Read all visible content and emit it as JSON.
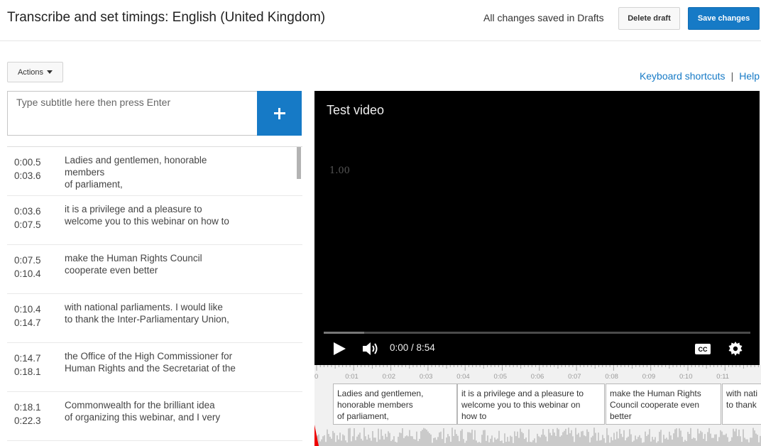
{
  "header": {
    "title": "Transcribe and set timings: English (United Kingdom)",
    "saved_status": "All changes saved in Drafts",
    "delete_label": "Delete draft",
    "save_label": "Save changes"
  },
  "toolbar": {
    "actions_label": "Actions",
    "keyboard_shortcuts": "Keyboard shortcuts",
    "separator": "|",
    "help": "Help"
  },
  "subtitle_input": {
    "placeholder": "Type subtitle here then press Enter"
  },
  "subtitles": [
    {
      "start": "0:00.5",
      "end": "0:03.6",
      "lines": [
        "Ladies and gentlemen, honorable",
        "members",
        "of parliament,"
      ]
    },
    {
      "start": "0:03.6",
      "end": "0:07.5",
      "lines": [
        "it is a privilege and a pleasure to",
        "welcome you to this webinar on how to"
      ]
    },
    {
      "start": "0:07.5",
      "end": "0:10.4",
      "lines": [
        "make the Human Rights Council",
        "cooperate even better"
      ]
    },
    {
      "start": "0:10.4",
      "end": "0:14.7",
      "lines": [
        "with national parliaments. I would like",
        "to thank the Inter-Parliamentary Union,"
      ]
    },
    {
      "start": "0:14.7",
      "end": "0:18.1",
      "lines": [
        "the Office of the High Commissioner for",
        "Human Rights and the Secretariat of the"
      ]
    },
    {
      "start": "0:18.1",
      "end": "0:22.3",
      "lines": [
        "Commonwealth for the brilliant idea",
        "of organizing this webinar, and I very"
      ]
    }
  ],
  "player": {
    "video_title": "Test video",
    "speed": "1.00",
    "timecode": "0:00 / 8:54",
    "cc_label": "CC",
    "progress": 0.095
  },
  "timeline": {
    "tick_labels": [
      "0",
      "0:01",
      "0:02",
      "0:03",
      "0:04",
      "0:05",
      "0:06",
      "0:07",
      "0:08",
      "0:09",
      "0:10",
      "0:11"
    ],
    "cues": [
      [
        "Ladies and gentlemen,",
        "honorable members",
        "of parliament,"
      ],
      [
        "it is a privilege and a pleasure to",
        "welcome you to this webinar on",
        "how to"
      ],
      [
        "make the Human Rights",
        "Council cooperate even",
        "better"
      ],
      [
        "with nati",
        "to thank"
      ]
    ]
  }
}
